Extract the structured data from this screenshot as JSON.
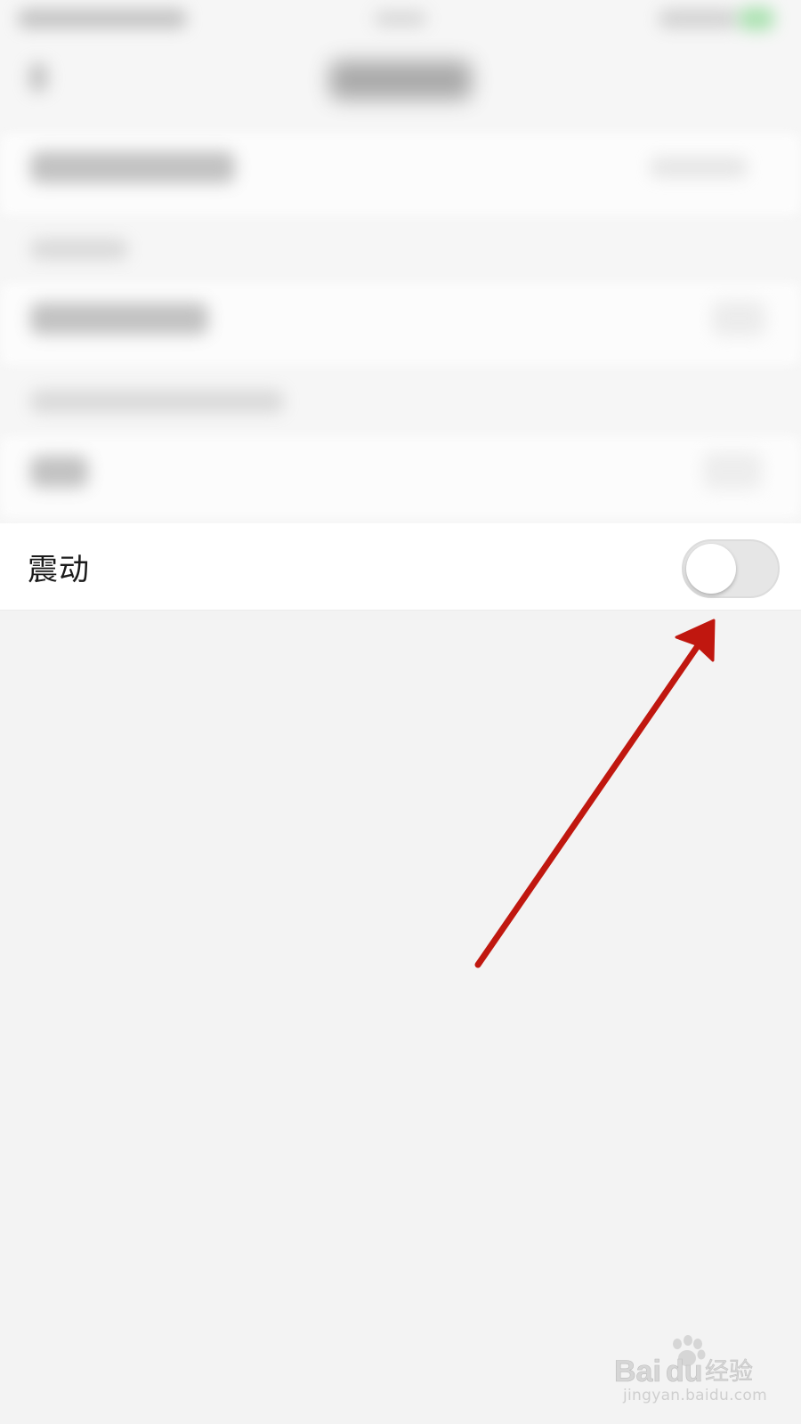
{
  "setting": {
    "label": "震动",
    "toggle_on": false
  },
  "colors": {
    "background": "#f3f3f3",
    "row_background": "#ffffff",
    "toggle_off_track": "#e6e6e6",
    "annotation_arrow": "#c0170f"
  },
  "watermark": {
    "brand": "Baidu经验",
    "url": "jingyan.baidu.com"
  }
}
